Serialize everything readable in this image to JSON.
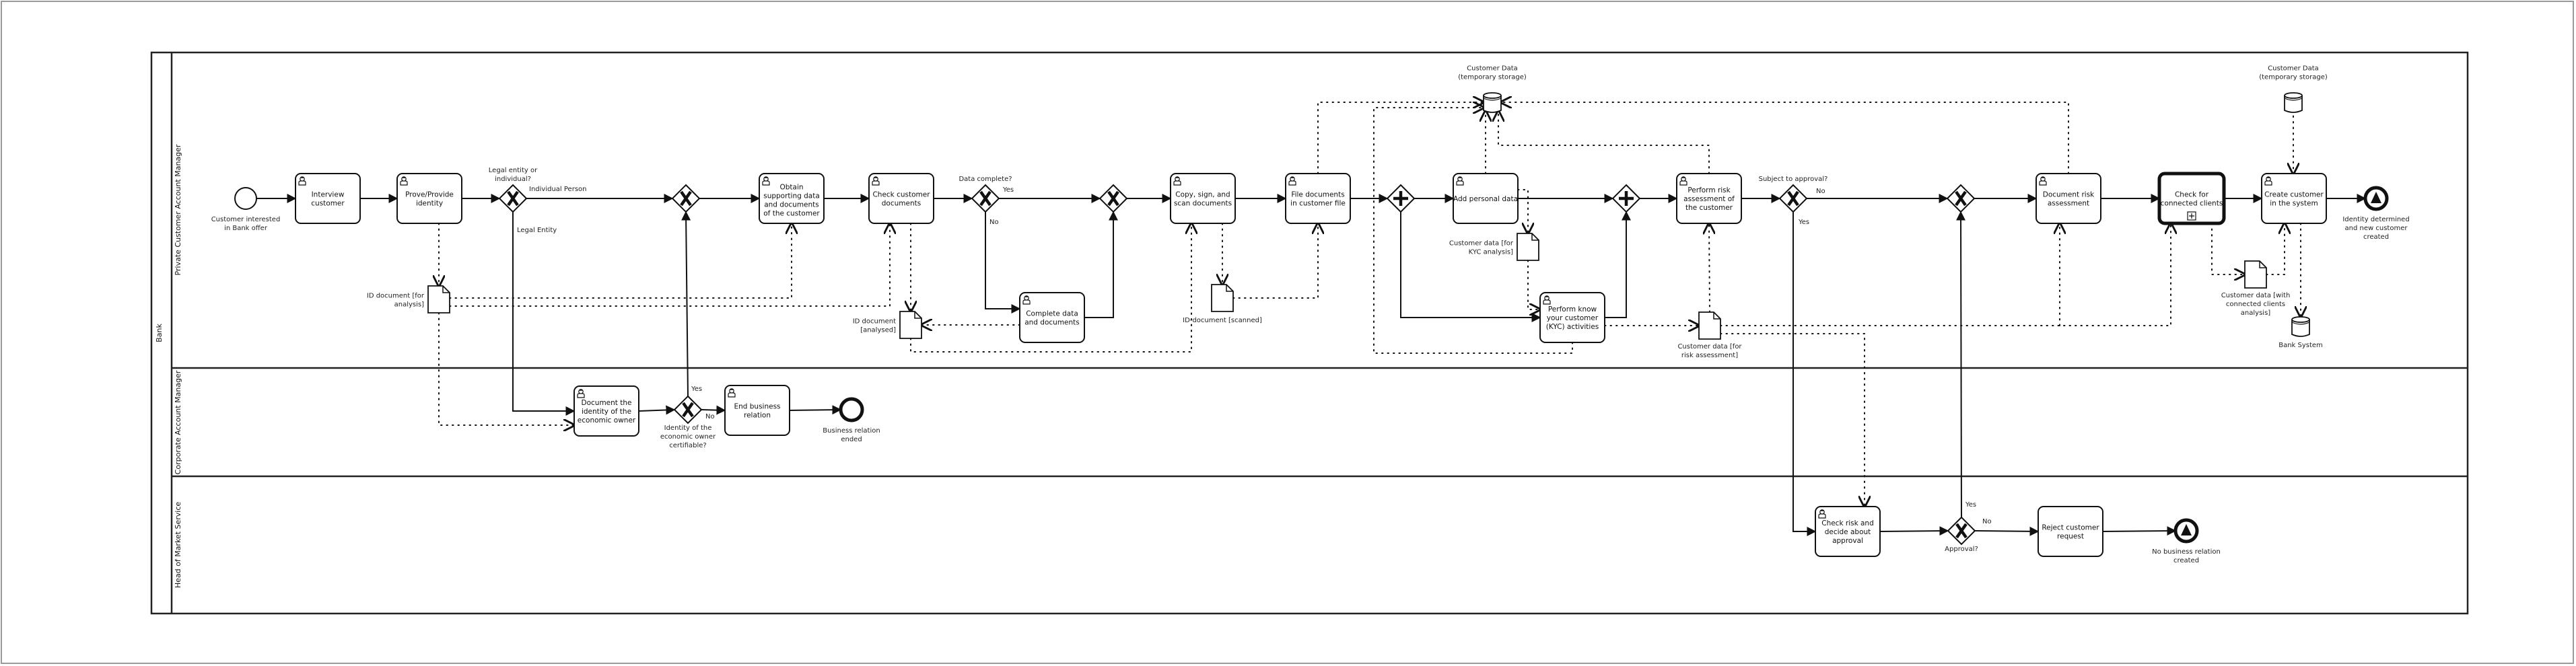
{
  "pool": {
    "label": "Bank"
  },
  "lanes": [
    {
      "id": "pcam",
      "label": "Private Customer Account Manager"
    },
    {
      "id": "cam",
      "label": "Corporate Account Manager"
    },
    {
      "id": "hms",
      "label": "Head of Market Service"
    }
  ],
  "events": [
    {
      "id": "start",
      "type": "start",
      "label": [
        "Customer interested",
        "in Bank offer"
      ]
    },
    {
      "id": "end_relation",
      "type": "end",
      "label": [
        "Business relation",
        "ended"
      ]
    },
    {
      "id": "end_identity",
      "type": "end-signal",
      "label": [
        "Identity determined",
        "and new customer",
        "created"
      ]
    },
    {
      "id": "end_no_relation",
      "type": "end-signal",
      "label": [
        "No business relation",
        "created"
      ]
    }
  ],
  "tasks": [
    {
      "id": "t_interview",
      "label": [
        "Interview",
        "customer"
      ],
      "kind": "user"
    },
    {
      "id": "t_prove",
      "label": [
        "Prove/Provide",
        "identity"
      ],
      "kind": "user"
    },
    {
      "id": "t_obtain",
      "label": [
        "Obtain",
        "supporting data",
        "and documents",
        "of the customer"
      ],
      "kind": "user"
    },
    {
      "id": "t_check_docs",
      "label": [
        "Check customer",
        "documents"
      ],
      "kind": "user"
    },
    {
      "id": "t_complete",
      "label": [
        "Complete data",
        "and documents"
      ],
      "kind": "user"
    },
    {
      "id": "t_copy",
      "label": [
        "Copy, sign, and",
        "scan documents"
      ],
      "kind": "user"
    },
    {
      "id": "t_file",
      "label": [
        "File documents",
        "in customer file"
      ],
      "kind": "user"
    },
    {
      "id": "t_add",
      "label": [
        "Add personal data"
      ],
      "kind": "user"
    },
    {
      "id": "t_kyc",
      "label": [
        "Perform know",
        "your customer",
        "(KYC) activities"
      ],
      "kind": "user"
    },
    {
      "id": "t_risk",
      "label": [
        "Perform risk",
        "assessment of",
        "the customer"
      ],
      "kind": "user"
    },
    {
      "id": "t_doc_risk",
      "label": [
        "Document risk",
        "assessment"
      ],
      "kind": "user"
    },
    {
      "id": "t_connected",
      "label": [
        "Check for",
        "connected clients"
      ],
      "kind": "subprocess"
    },
    {
      "id": "t_create",
      "label": [
        "Create customer",
        "in the system"
      ],
      "kind": "user"
    },
    {
      "id": "t_doc_owner",
      "label": [
        "Document the",
        "identity of the",
        "economic owner"
      ],
      "kind": "user"
    },
    {
      "id": "t_end_rel",
      "label": [
        "End business",
        "relation"
      ],
      "kind": "user"
    },
    {
      "id": "t_check_risk",
      "label": [
        "Check risk and",
        "decide about",
        "approval"
      ],
      "kind": "user"
    },
    {
      "id": "t_reject",
      "label": [
        "Reject customer",
        "request"
      ],
      "kind": "plain"
    }
  ],
  "gateways": [
    {
      "id": "g_legal",
      "type": "exclusive",
      "label": [
        "Legal entity or",
        "individual?"
      ]
    },
    {
      "id": "g_merge1",
      "type": "exclusive",
      "label": []
    },
    {
      "id": "g_data",
      "type": "exclusive",
      "label": [
        "Data complete?"
      ]
    },
    {
      "id": "g_merge2",
      "type": "exclusive",
      "label": []
    },
    {
      "id": "g_par_split",
      "type": "parallel",
      "label": []
    },
    {
      "id": "g_par_join",
      "type": "parallel",
      "label": []
    },
    {
      "id": "g_approval_q",
      "type": "exclusive",
      "label": [
        "Subject to approval?"
      ]
    },
    {
      "id": "g_merge3",
      "type": "exclusive",
      "label": []
    },
    {
      "id": "g_owner",
      "type": "exclusive",
      "label": [
        "Identity of the",
        "economic owner",
        "certifiable?"
      ]
    },
    {
      "id": "g_approval",
      "type": "exclusive",
      "label": [
        "Approval?"
      ]
    }
  ],
  "data_objects": [
    {
      "id": "d_id_analysis",
      "label": [
        "ID document [for",
        "analysis]"
      ]
    },
    {
      "id": "d_id_analysed",
      "label": [
        "ID document",
        "[analysed]"
      ]
    },
    {
      "id": "d_id_scanned",
      "label": [
        "ID-document [scanned]"
      ]
    },
    {
      "id": "d_kyc",
      "label": [
        "Customer data [for",
        "KYC analysis]"
      ]
    },
    {
      "id": "d_risk",
      "label": [
        "Customer data [for",
        "risk assessment]"
      ]
    },
    {
      "id": "d_connected",
      "label": [
        "Customer data [with",
        "connected clients",
        "analysis]"
      ]
    }
  ],
  "data_stores": [
    {
      "id": "s_temp1",
      "label": [
        "Customer Data",
        "(temporary storage)"
      ]
    },
    {
      "id": "s_temp2",
      "label": [
        "Customer Data",
        "(temporary storage)"
      ]
    },
    {
      "id": "s_bank",
      "label": [
        "Bank System"
      ]
    }
  ],
  "flow_labels": {
    "individual": "Individual Person",
    "legal": "Legal Entity",
    "data_yes": "Yes",
    "data_no": "No",
    "approval_q_no": "No",
    "approval_q_yes": "Yes",
    "owner_yes": "Yes",
    "owner_no": "No",
    "approval_yes": "Yes",
    "approval_no": "No"
  }
}
